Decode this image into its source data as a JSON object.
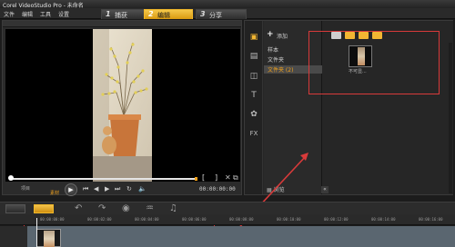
{
  "window": {
    "title": "Corel VideoStudio Pro - 未命名"
  },
  "menu": {
    "items": [
      "文件",
      "编辑",
      "工具",
      "设置"
    ]
  },
  "steps": [
    {
      "num": "1",
      "label": "捕获",
      "active": false
    },
    {
      "num": "2",
      "label": "编辑",
      "active": true
    },
    {
      "num": "3",
      "label": "分享",
      "active": false
    }
  ],
  "player": {
    "mode_label": "项目",
    "mode_value": "素材",
    "timecode": "00:00:00:00",
    "bracket_in": "[",
    "bracket_out": "]"
  },
  "library": {
    "add_label": "添加",
    "tree": [
      {
        "label": "样本",
        "selected": false
      },
      {
        "label": "文件夹",
        "selected": false
      },
      {
        "label": "文件夹 (2)",
        "selected": true
      }
    ],
    "browse_label": "浏览",
    "thumb_label": "不可显...",
    "filters": [
      {
        "icon": "video-filter-icon",
        "color": "#cfcfcf"
      },
      {
        "icon": "photo-filter-icon",
        "color": "#f2b632"
      },
      {
        "icon": "image-filter-icon",
        "color": "#f2b632"
      },
      {
        "icon": "audio-filter-icon",
        "color": "#f2b632"
      }
    ]
  },
  "timeline": {
    "ruler": [
      "00:00:00:00",
      "00:00:02:00",
      "00:00:04:00",
      "00:00:06:00",
      "00:00:08:00",
      "00:00:10:00",
      "00:00:12:00",
      "00:00:14:00",
      "00:00:16:00"
    ]
  },
  "colors": {
    "accent": "#f0a11c",
    "highlight": "#d83a3a",
    "active_step": "#f1b82a"
  }
}
